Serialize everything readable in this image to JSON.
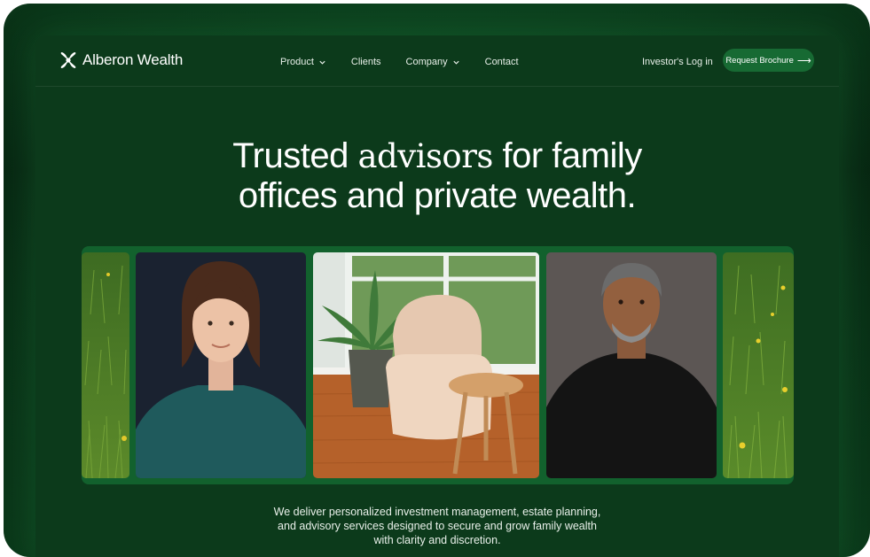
{
  "brand": {
    "name": "Alberon Wealth"
  },
  "nav": {
    "items": [
      {
        "label": "Product",
        "has_dropdown": true
      },
      {
        "label": "Clients",
        "has_dropdown": false
      },
      {
        "label": "Company",
        "has_dropdown": true
      },
      {
        "label": "Contact",
        "has_dropdown": false
      }
    ],
    "login_label": "Investor's Log in",
    "cta_label": "Request Brochure",
    "cta_icon": "arrow-right-icon"
  },
  "hero": {
    "headline_part1": "Trusted ",
    "headline_emphasis": "advisors",
    "headline_part2": " for family",
    "headline_line2": "offices and private wealth.",
    "body_line1": "We deliver personalized investment management, estate planning,",
    "body_line2": "and advisory services designed to secure and grow family wealth",
    "body_line3": "with clarity and discretion."
  },
  "gallery": {
    "tiles": [
      {
        "name": "grass-photo-left",
        "subject": "grass field"
      },
      {
        "name": "woman-portrait",
        "subject": "woman portrait"
      },
      {
        "name": "armchair-interior",
        "subject": "armchair and plant interior"
      },
      {
        "name": "man-portrait",
        "subject": "man portrait"
      },
      {
        "name": "grass-photo-right",
        "subject": "grass field with dandelions"
      }
    ]
  },
  "colors": {
    "background": "#0c3a1b",
    "accent": "#176a33",
    "text": "#ffffff"
  }
}
